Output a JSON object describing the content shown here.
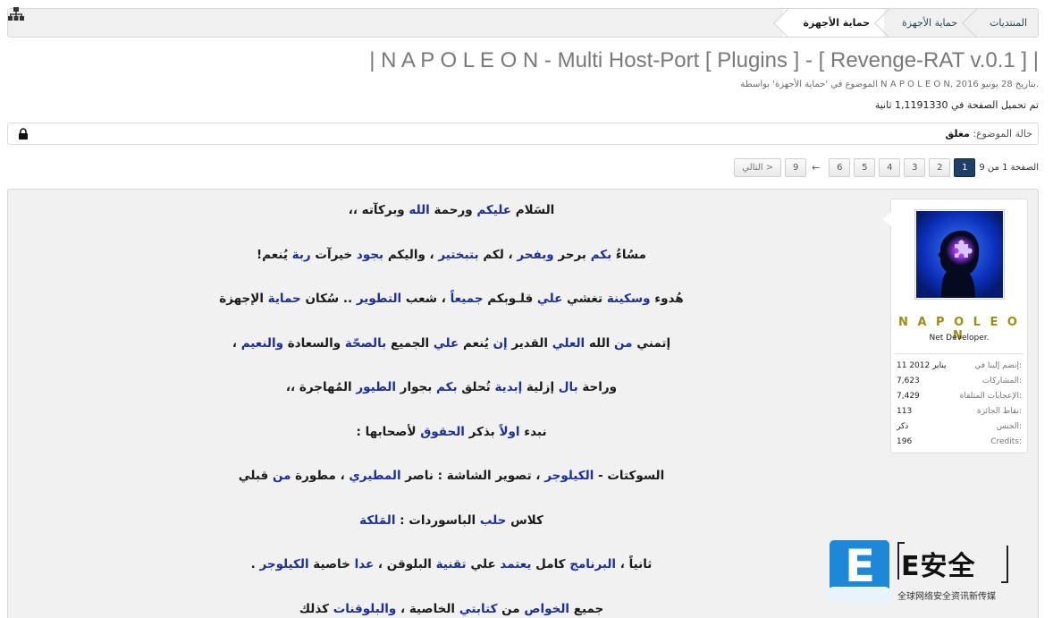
{
  "breadcrumb": {
    "items": [
      {
        "label": "المنتديات"
      },
      {
        "label": "حماية الأجهزة"
      },
      {
        "label": "حماية الأجهزة"
      }
    ]
  },
  "thread": {
    "title": "| N A P O L E O N - Multi Host-Port [ Plugins ] - [ Revenge-RAT v.0.1 ] |",
    "meta": "الموضوع في 'حماية الأجهزة' بواسطة N A P O L E O N, بتاريخ 28 يونيو 2016.",
    "load_time": "تم تحميل الصفحة في 1,1191330 ثانية"
  },
  "status": {
    "label": "حالة الموضوع:",
    "value": "مغلق",
    "icon": "lock-icon"
  },
  "pagination": {
    "label": "الصفحة 1 من 9",
    "pages": [
      "1",
      "2",
      "3",
      "4",
      "5",
      "6"
    ],
    "current": "1",
    "separator": "←",
    "last": "9",
    "next_label": "التالي >"
  },
  "user": {
    "name": "N A P O L E O N",
    "title": "Net Developer.",
    "stats": [
      {
        "label": "إنضم إلينا في:",
        "value": "11 يناير 2012"
      },
      {
        "label": "المشاركات:",
        "value": "7,623"
      },
      {
        "label": "الإعجابات المتلقاة:",
        "value": "7,429"
      },
      {
        "label": "نقاط الجائزة:",
        "value": "113"
      },
      {
        "label": "الجنس:",
        "value": "ذكر"
      },
      {
        "label": "Credits:",
        "value": "196"
      }
    ]
  },
  "post": {
    "l1": [
      "السَلام ",
      "عليكم",
      " ورحمة ",
      "الله",
      " وبركآته ،،"
    ],
    "l2": [
      "مسُاءُ ",
      "بكم",
      " برحر ",
      "وبفحر",
      " ، لكم ",
      "بتبختير",
      " ، واليكم ",
      "بجود",
      " خيرآت ",
      "ربة",
      " يُنعم!"
    ],
    "l3": [
      "هُدوء ",
      "وسكينة",
      " تغشي ",
      "علي",
      " قلـوبكم ",
      "جميعاً",
      " ، شعب ",
      "التطوير",
      " .. سُكان ",
      "حماية",
      " الإجهزة"
    ],
    "l4": [
      "إتمني ",
      "من",
      " الله ",
      "العلي",
      " القدير ",
      "إن",
      " يُنعم ",
      "علي",
      " الجميع ",
      "بالصحّة",
      " والسعادة ",
      "والنعيم",
      " ،"
    ],
    "l5": [
      "وراحة ",
      "بال",
      " إزلية ",
      "إبدية",
      " تُحلق ",
      "بكم",
      " بجوار ",
      "الطيور",
      " المُهاجرة ،،"
    ],
    "l6": [
      "نبدء ",
      "اولاً",
      " بذكر ",
      "الحقوق",
      " لأصحابها :"
    ],
    "l7": [
      "السوكتات - ",
      "الكيلوجر",
      " ، تصوير الشاشة : ناصر ",
      "المطيري",
      " ، مطورة ",
      "من",
      " قبلي"
    ],
    "l8": [
      "كلاس ",
      "حلب",
      " الباسوردات : ",
      "المَلكة",
      ""
    ],
    "l9": [
      "ثانياً ، ",
      "البرنامج",
      " كامل ",
      "يعتمد",
      " علي ",
      "تقنية",
      " البلوقن ، ",
      "عدا",
      " خاصية ",
      "الكيلوجر",
      " ."
    ],
    "l10": [
      "جميع ",
      "الخواص",
      " من ",
      "كتابتي",
      " الخاصية ، ",
      "والبلوقنات",
      " كذلك"
    ]
  },
  "watermark": {
    "letter": "E",
    "brand": "E安全",
    "tagline": "全球网络安全资讯新传媒"
  },
  "colors": {
    "accent": "#1f3f6b",
    "keyword": "#1d2f9c",
    "username": "#9b9015",
    "post_bg": "#f1f1f1"
  }
}
